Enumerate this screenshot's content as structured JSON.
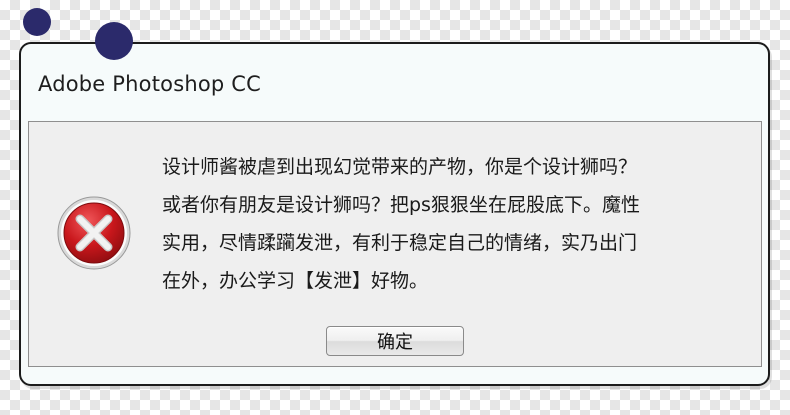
{
  "window": {
    "title": "Adobe Photoshop CC"
  },
  "dialog": {
    "icon": "error-x-icon",
    "message": "设计师酱被虐到出现幻觉带来的产物，你是个设计狮吗？\n或者你有朋友是设计狮吗？把ps狠狠坐在屁股底下。魔性\n实用，尽情蹂躏发泄，有利于稳定自己的情绪，实乃出门\n在外，办公学习【发泄】好物。",
    "ok_label": "确定"
  },
  "colors": {
    "decor_dot": "#2b2a6b",
    "error_red": "#c21c1f",
    "window_frame": "#1c1c1c"
  }
}
